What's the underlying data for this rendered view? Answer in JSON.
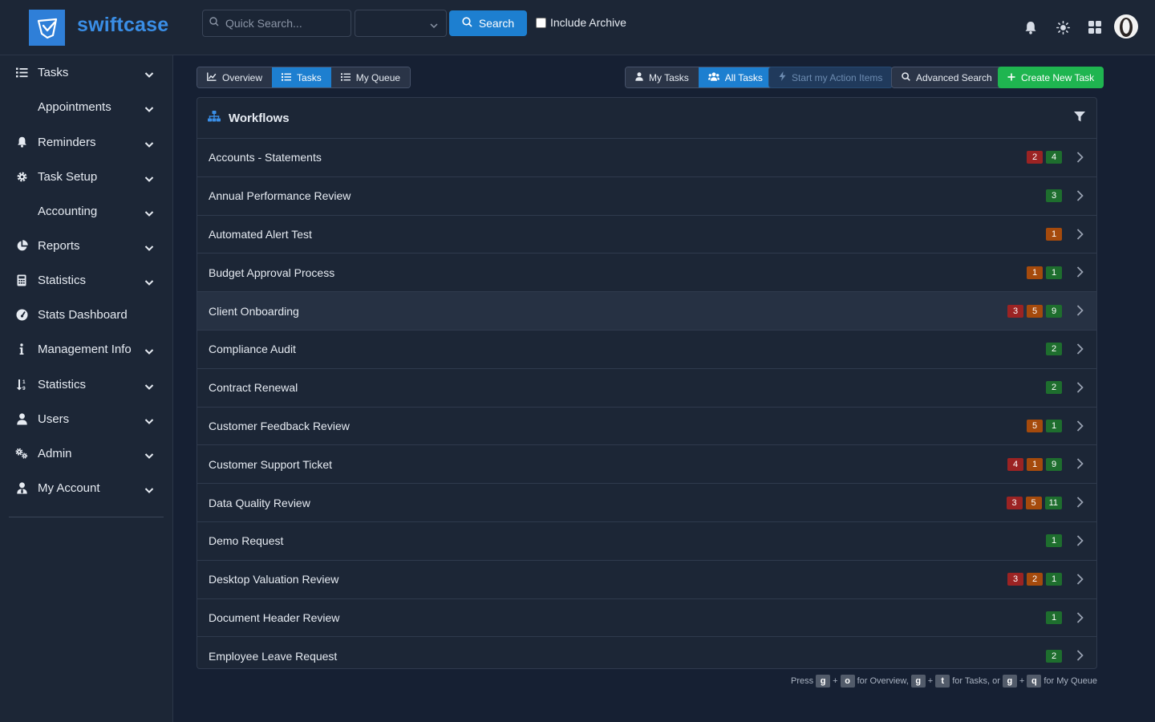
{
  "app": {
    "brand": "swiftcase"
  },
  "header": {
    "search_placeholder": "Quick Search...",
    "select_value": "",
    "search_button": "Search",
    "archive_label": "Include Archive"
  },
  "sidebar": {
    "items": [
      {
        "label": "Tasks",
        "icon": "list-icon"
      },
      {
        "label": "Appointments",
        "icon": ""
      },
      {
        "label": "Reminders",
        "icon": "bell-icon"
      },
      {
        "label": "Task Setup",
        "icon": "gear-icon"
      },
      {
        "label": "Accounting",
        "icon": ""
      },
      {
        "label": "Reports",
        "icon": "pie-chart-icon"
      },
      {
        "label": "Statistics",
        "icon": "calculator-icon"
      },
      {
        "label": "Stats Dashboard",
        "icon": "gauge-icon"
      },
      {
        "label": "Management Info",
        "icon": "info-icon"
      },
      {
        "label": "Statistics",
        "icon": "sort-icon"
      },
      {
        "label": "Users",
        "icon": "user-icon"
      },
      {
        "label": "Admin",
        "icon": "gears-icon"
      },
      {
        "label": "My Account",
        "icon": "user-tie-icon"
      }
    ]
  },
  "toolbar": {
    "overview": "Overview",
    "tasks": "Tasks",
    "my_queue": "My Queue",
    "my_tasks": "My Tasks",
    "all_tasks": "All Tasks",
    "start_action": "Start my Action Items",
    "advanced_search": "Advanced Search",
    "create_task": "Create New Task"
  },
  "workflows": {
    "title": "Workflows",
    "rows": [
      {
        "name": "Accounts - Statements",
        "badges": [
          {
            "v": "2",
            "c": "red"
          },
          {
            "v": "4",
            "c": "green"
          }
        ]
      },
      {
        "name": "Annual Performance Review",
        "badges": [
          {
            "v": "3",
            "c": "green"
          }
        ]
      },
      {
        "name": "Automated Alert Test",
        "badges": [
          {
            "v": "1",
            "c": "orange"
          }
        ]
      },
      {
        "name": "Budget Approval Process",
        "badges": [
          {
            "v": "1",
            "c": "orange"
          },
          {
            "v": "1",
            "c": "green"
          }
        ]
      },
      {
        "name": "Client Onboarding",
        "badges": [
          {
            "v": "3",
            "c": "red"
          },
          {
            "v": "5",
            "c": "orange"
          },
          {
            "v": "9",
            "c": "green"
          }
        ],
        "highlight": true
      },
      {
        "name": "Compliance Audit",
        "badges": [
          {
            "v": "2",
            "c": "green"
          }
        ]
      },
      {
        "name": "Contract Renewal",
        "badges": [
          {
            "v": "2",
            "c": "green"
          }
        ]
      },
      {
        "name": "Customer Feedback Review",
        "badges": [
          {
            "v": "5",
            "c": "orange"
          },
          {
            "v": "1",
            "c": "green"
          }
        ]
      },
      {
        "name": "Customer Support Ticket",
        "badges": [
          {
            "v": "4",
            "c": "red"
          },
          {
            "v": "1",
            "c": "orange"
          },
          {
            "v": "9",
            "c": "green"
          }
        ]
      },
      {
        "name": "Data Quality Review",
        "badges": [
          {
            "v": "3",
            "c": "red"
          },
          {
            "v": "5",
            "c": "orange"
          },
          {
            "v": "11",
            "c": "green"
          }
        ]
      },
      {
        "name": "Demo Request",
        "badges": [
          {
            "v": "1",
            "c": "green"
          }
        ]
      },
      {
        "name": "Desktop Valuation Review",
        "badges": [
          {
            "v": "3",
            "c": "red"
          },
          {
            "v": "2",
            "c": "orange"
          },
          {
            "v": "1",
            "c": "green"
          }
        ]
      },
      {
        "name": "Document Header Review",
        "badges": [
          {
            "v": "1",
            "c": "green"
          }
        ]
      },
      {
        "name": "Employee Leave Request",
        "badges": [
          {
            "v": "2",
            "c": "green"
          }
        ]
      }
    ]
  },
  "hint": {
    "press": "Press",
    "k1": "g",
    "k2": "o",
    "t1": "for Overview,",
    "k3": "g",
    "k4": "t",
    "t2": "for Tasks, or",
    "k5": "g",
    "k6": "q",
    "t3": "for My Queue",
    "plus": "+"
  },
  "colors": {
    "accent": "#1d7fd0",
    "success": "#1fb550",
    "badge_red": "#9b2323",
    "badge_orange": "#a54a0c",
    "badge_green": "#1e6e2e"
  }
}
